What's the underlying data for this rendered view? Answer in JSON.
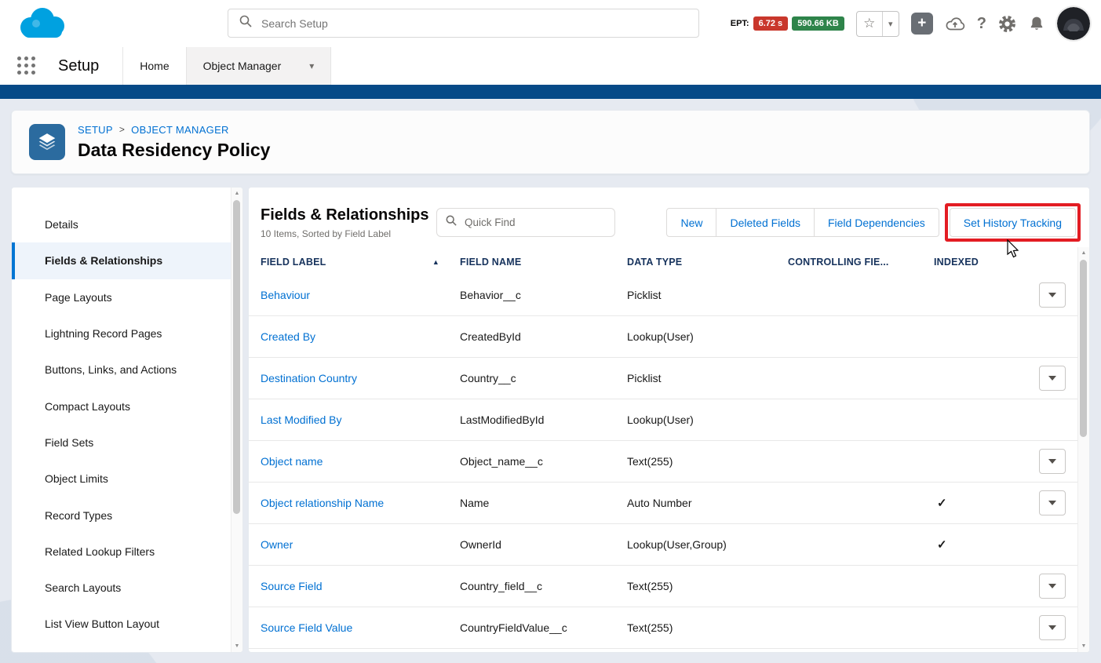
{
  "colors": {
    "brand_blue": "#0176d3",
    "link_blue": "#0070d2",
    "ept_badge_red": "#c9372c",
    "size_badge_green": "#2e844a",
    "header_band_navy": "#064a87",
    "annotation_red": "#e31c23",
    "object_icon_blue": "#2b6b9f"
  },
  "global_header": {
    "search_placeholder": "Search Setup",
    "ept_label": "EPT:",
    "ept_value": "6.72 s",
    "page_size": "590.66 KB"
  },
  "nav": {
    "app_name": "Setup",
    "tabs": [
      {
        "label": "Home",
        "active": false,
        "has_menu": false
      },
      {
        "label": "Object Manager",
        "active": true,
        "has_menu": true
      }
    ]
  },
  "page_header": {
    "breadcrumb": [
      {
        "label": "SETUP"
      },
      {
        "label": "OBJECT MANAGER"
      }
    ],
    "breadcrumb_separator": ">",
    "title": "Data Residency Policy"
  },
  "sidebar": {
    "items": [
      {
        "label": "Details",
        "active": false
      },
      {
        "label": "Fields & Relationships",
        "active": true
      },
      {
        "label": "Page Layouts",
        "active": false
      },
      {
        "label": "Lightning Record Pages",
        "active": false
      },
      {
        "label": "Buttons, Links, and Actions",
        "active": false
      },
      {
        "label": "Compact Layouts",
        "active": false
      },
      {
        "label": "Field Sets",
        "active": false
      },
      {
        "label": "Object Limits",
        "active": false
      },
      {
        "label": "Record Types",
        "active": false
      },
      {
        "label": "Related Lookup Filters",
        "active": false
      },
      {
        "label": "Search Layouts",
        "active": false
      },
      {
        "label": "List View Button Layout",
        "active": false
      }
    ]
  },
  "main": {
    "title": "Fields & Relationships",
    "subtitle": "10 Items, Sorted by Field Label",
    "quick_find": {
      "placeholder": "Quick Find"
    },
    "buttons": [
      {
        "label": "New",
        "highlighted": false
      },
      {
        "label": "Deleted Fields",
        "highlighted": false
      },
      {
        "label": "Field Dependencies",
        "highlighted": false
      },
      {
        "label": "Set History Tracking",
        "highlighted": true
      }
    ],
    "table": {
      "columns": [
        {
          "label": "FIELD LABEL",
          "sorted": true
        },
        {
          "label": "FIELD NAME",
          "sorted": false
        },
        {
          "label": "DATA TYPE",
          "sorted": false
        },
        {
          "label": "CONTROLLING FIE...",
          "sorted": false
        },
        {
          "label": "INDEXED",
          "sorted": false
        }
      ],
      "rows": [
        {
          "field_label": "Behaviour",
          "field_name": "Behavior__c",
          "data_type": "Picklist",
          "controlling": "",
          "indexed": false,
          "has_menu": true
        },
        {
          "field_label": "Created By",
          "field_name": "CreatedById",
          "data_type": "Lookup(User)",
          "controlling": "",
          "indexed": false,
          "has_menu": false
        },
        {
          "field_label": "Destination Country",
          "field_name": "Country__c",
          "data_type": "Picklist",
          "controlling": "",
          "indexed": false,
          "has_menu": true
        },
        {
          "field_label": "Last Modified By",
          "field_name": "LastModifiedById",
          "data_type": "Lookup(User)",
          "controlling": "",
          "indexed": false,
          "has_menu": false
        },
        {
          "field_label": "Object name",
          "field_name": "Object_name__c",
          "data_type": "Text(255)",
          "controlling": "",
          "indexed": false,
          "has_menu": true
        },
        {
          "field_label": "Object relationship Name",
          "field_name": "Name",
          "data_type": "Auto Number",
          "controlling": "",
          "indexed": true,
          "has_menu": true
        },
        {
          "field_label": "Owner",
          "field_name": "OwnerId",
          "data_type": "Lookup(User,Group)",
          "controlling": "",
          "indexed": true,
          "has_menu": false
        },
        {
          "field_label": "Source Field",
          "field_name": "Country_field__c",
          "data_type": "Text(255)",
          "controlling": "",
          "indexed": false,
          "has_menu": true
        },
        {
          "field_label": "Source Field Value",
          "field_name": "CountryFieldValue__c",
          "data_type": "Text(255)",
          "controlling": "",
          "indexed": false,
          "has_menu": true
        }
      ]
    }
  },
  "icons": {
    "chevron_down": "▾",
    "caret_down": "▾",
    "sort_asc": "▲",
    "check": "✓",
    "star": "☆",
    "plus": "+",
    "help": "?",
    "scroll_up": "▲",
    "scroll_down": "▼"
  }
}
